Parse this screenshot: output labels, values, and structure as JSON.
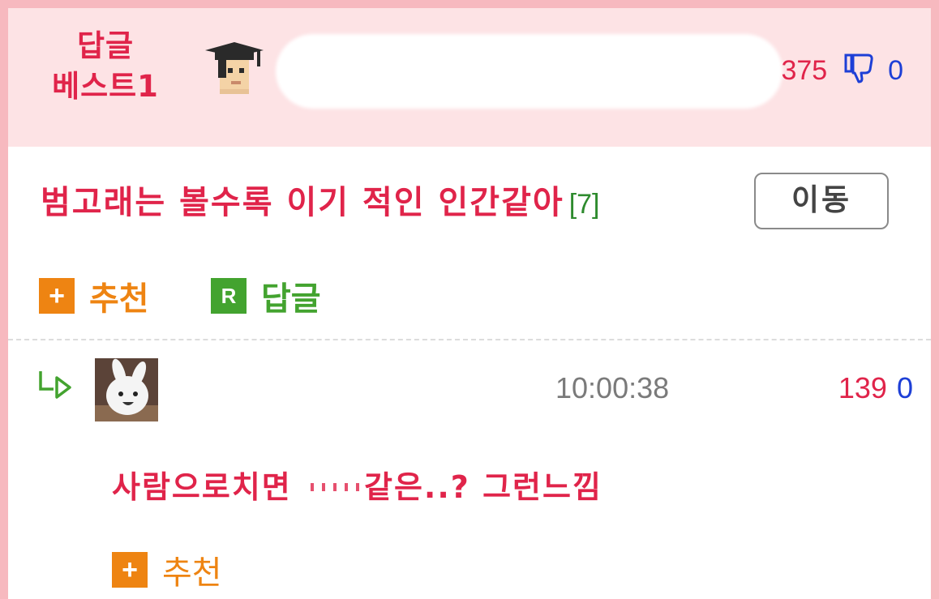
{
  "best_reply": {
    "label_line1": "답글",
    "label_line2": "베스트1",
    "like_count": "375",
    "dislike_count": "0"
  },
  "post": {
    "title": "범고래는 볼수록 이기 적인 인간같아",
    "reply_count": "[7]",
    "move_button": "이동",
    "recommend_label": "추천",
    "reply_label": "답글",
    "recommend_icon": "+",
    "reply_icon": "R"
  },
  "reply": {
    "time": "10:00:38",
    "like_count": "139",
    "dislike_count": "0",
    "text_before": "사람으로치면",
    "text_after": "같은..? 그런느낌",
    "recommend_label": "추천",
    "recommend_icon": "+"
  },
  "colors": {
    "accent_red": "#e0244a",
    "header_bg": "#fde3e5",
    "frame_pink": "#f7b9bf",
    "orange": "#ee8412",
    "green": "#43a32f",
    "blue": "#1d3fd6"
  }
}
